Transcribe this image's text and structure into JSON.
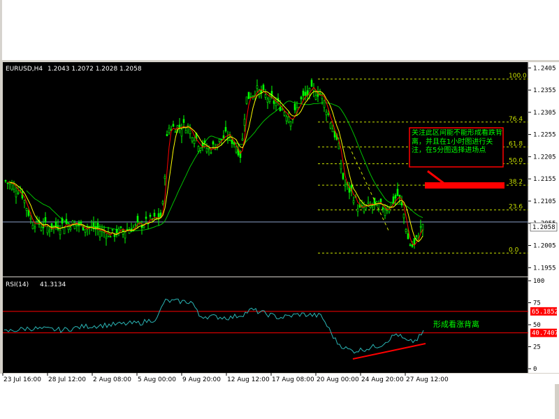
{
  "window": {
    "title": ""
  },
  "chart_data": [
    {
      "type": "candlestick",
      "symbol_label": "EURUSD,H4",
      "ohlc_label": "1.2043 1.2072 1.2028 1.2058",
      "y_axis_ticks": [
        "1.2405",
        "1.2355",
        "1.2305",
        "1.2255",
        "1.2205",
        "1.2155",
        "1.2105",
        "1.2055",
        "1.2005",
        "1.1955"
      ],
      "ylim": [
        1.1935,
        1.2418
      ],
      "current_price": 1.2058,
      "current_price_label": "1.2058",
      "x_axis_ticks": [
        "23 Jul 16:00",
        "28 Jul 12:00",
        "2 Aug 08:00",
        "5 Aug 00:00",
        "9 Aug 20:00",
        "12 Aug 12:00",
        "17 Aug 08:00",
        "20 Aug 00:00",
        "24 Aug 20:00",
        "27 Aug 12:00"
      ],
      "fibonacci_levels": [
        {
          "label": "100.0",
          "value": 1.238
        },
        {
          "label": "76.4",
          "value": 1.2283
        },
        {
          "label": "61.8",
          "value": 1.2227
        },
        {
          "label": "50.0",
          "value": 1.2189
        },
        {
          "label": "38.2",
          "value": 1.2141
        },
        {
          "label": "23.6",
          "value": 1.2085
        },
        {
          "label": "0.0",
          "value": 1.1988
        }
      ],
      "annotation_text": "关注此区间能不能形成看跌背离，并且在1小时图进行关注，在5分图选择进场点",
      "trend": "range 1.2030–1.2120 late Jul, breakout to 1.2380 mid-Aug, decline to 1.1988 on 27 Aug",
      "colors": {
        "bull": "#00ff00",
        "bear": "#00ff00",
        "ma_fast": "#ffff00",
        "ma_mid": "#ff0000",
        "ma_slow": "#00c000",
        "fib": "#c8e000",
        "annotation": "#ff0000"
      }
    },
    {
      "type": "line",
      "label": "RSI(14)",
      "value_label": "41.3134",
      "y_axis_ticks": [
        "100",
        "75",
        "50",
        "25",
        "0"
      ],
      "ylim": [
        0,
        100
      ],
      "levels": [
        {
          "label": "65.1852",
          "value": 65.1852
        },
        {
          "label": "40.7407",
          "value": 40.7407
        }
      ],
      "annotation_text": "形成看涨背离",
      "colors": {
        "line": "#2ab5b5",
        "level": "#ff0000",
        "annotation": "#00ff00"
      }
    }
  ]
}
